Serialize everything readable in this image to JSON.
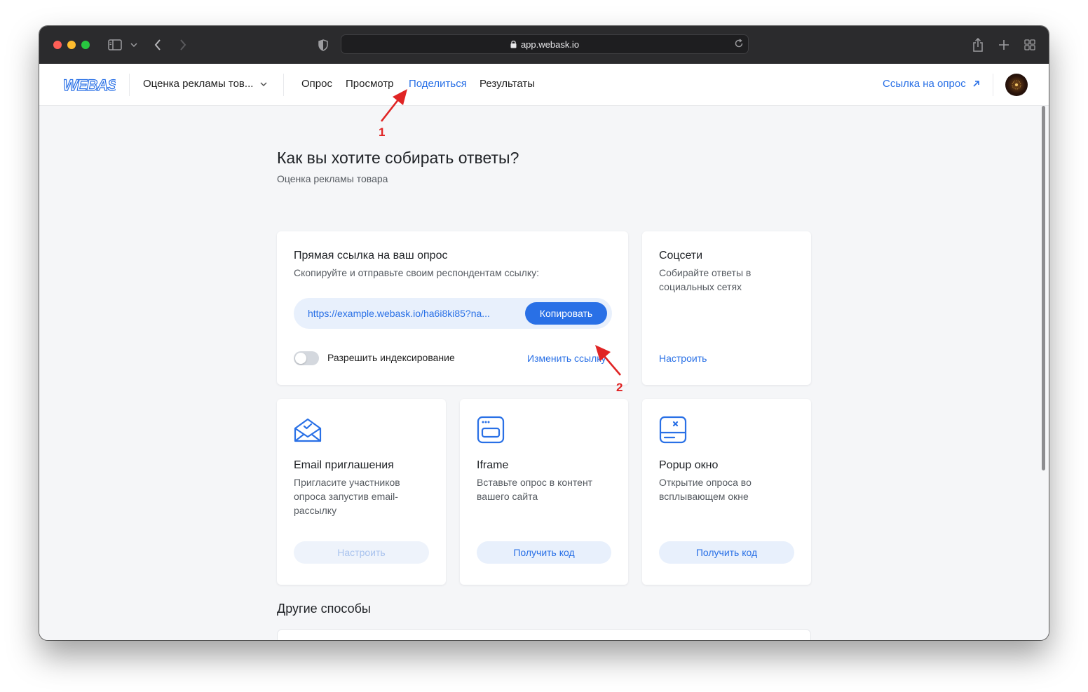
{
  "browser": {
    "url": "app.webask.io"
  },
  "header": {
    "logo_text": "WEBASK",
    "survey_name": "Оценка рекламы тов...",
    "nav": {
      "survey": "Опрос",
      "preview": "Просмотр",
      "share": "Поделиться",
      "results": "Результаты"
    },
    "survey_link": "Ссылка на опрос"
  },
  "main": {
    "title": "Как вы хотите собирать ответы?",
    "subtitle": "Оценка рекламы товара",
    "direct_link": {
      "title": "Прямая ссылка на ваш опрос",
      "description": "Скопируйте и отправьте своим респондентам ссылку:",
      "url": "https://example.webask.io/ha6i8ki85?na...",
      "copy_label": "Копировать",
      "indexing_label": "Разрешить индексирование",
      "indexing_enabled": false,
      "change_link_label": "Изменить ссылку"
    },
    "social": {
      "title": "Соцсети",
      "description_line1": "Собирайте ответы в",
      "description_line2": "социальных сетях",
      "configure_label": "Настроить"
    },
    "email": {
      "title": "Email приглашения",
      "description_line1": "Пригласите участников",
      "description_line2": "опроса запустив email-",
      "description_line3": "рассылку",
      "button_label": "Настроить"
    },
    "iframe": {
      "title": "Iframe",
      "description_line1": "Вставьте опрос в контент",
      "description_line2": "вашего сайта",
      "button_label": "Получить код"
    },
    "popup": {
      "title": "Popup окно",
      "description_line1": "Открытие опроса во",
      "description_line2": "всплывающем окне",
      "button_label": "Получить код"
    },
    "other_title": "Другие способы"
  },
  "annotations": {
    "first": "1",
    "second": "2"
  },
  "colors": {
    "accent": "#2970e6",
    "annotation": "#e02424"
  }
}
